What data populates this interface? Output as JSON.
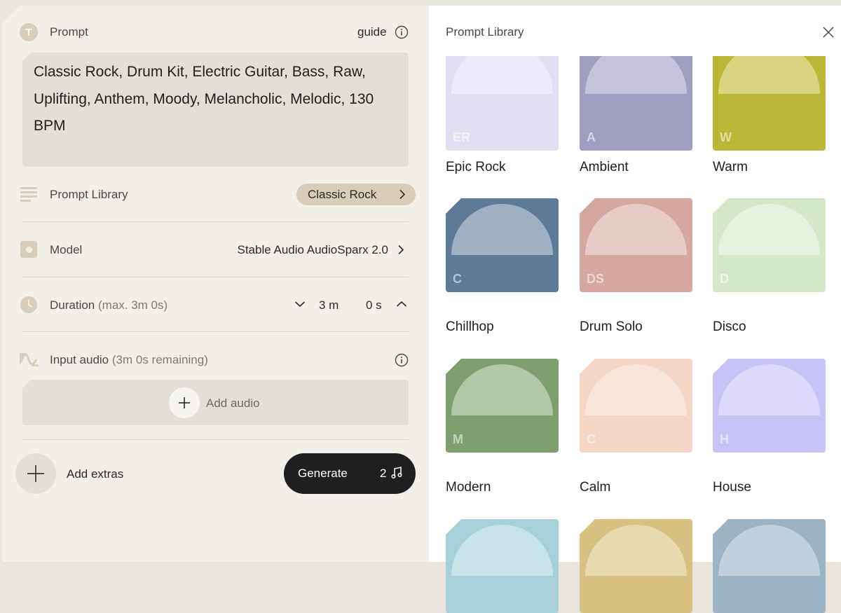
{
  "prompt_panel": {
    "title": "Prompt",
    "guide_label": "guide",
    "prompt_text": "Classic Rock, Drum Kit, Electric Guitar, Bass, Raw, Uplifting, Anthem, Moody, Melancholic, Melodic, 130 BPM",
    "prompt_library_label": "Prompt Library",
    "prompt_library_value": "Classic Rock",
    "model_label": "Model",
    "model_value": "Stable Audio AudioSparx 2.0",
    "duration_label": "Duration",
    "duration_hint": "(max. 3m 0s)",
    "duration_minutes": "3 m",
    "duration_seconds": "0 s",
    "input_audio_label": "Input audio",
    "input_audio_hint": "(3m 0s remaining)",
    "add_audio_label": "Add audio",
    "add_extras_label": "Add extras",
    "generate_label": "Generate",
    "generate_count": "2"
  },
  "library": {
    "title": "Prompt Library",
    "cards": [
      {
        "abbr": "ER",
        "title": "Epic Rock",
        "color": "#e2ddf0",
        "dome": "#ede9f6"
      },
      {
        "abbr": "A",
        "title": "Ambient",
        "color": "#a09fc0",
        "dome": "#c4c3d9"
      },
      {
        "abbr": "W",
        "title": "Warm",
        "color": "#bdb738",
        "dome": "#d8d482"
      },
      {
        "abbr": "C",
        "title": "Chillhop",
        "color": "#5d7a98",
        "dome": "#9fb0c3"
      },
      {
        "abbr": "DS",
        "title": "Drum Solo",
        "color": "#d6a6a0",
        "dome": "#e6cbc7"
      },
      {
        "abbr": "D",
        "title": "Disco",
        "color": "#d5e6cb",
        "dome": "#e6f0df"
      },
      {
        "abbr": "M",
        "title": "Modern",
        "color": "#7e9e6e",
        "dome": "#b3c6a8"
      },
      {
        "abbr": "C",
        "title": "Calm",
        "color": "#f3d6c4",
        "dome": "#f7e5da"
      },
      {
        "abbr": "H",
        "title": "House",
        "color": "#c7c3f7",
        "dome": "#dcd9fa"
      },
      {
        "abbr": "",
        "title": "",
        "color": "#a6d1d9",
        "dome": "#c8e3e8"
      },
      {
        "abbr": "",
        "title": "",
        "color": "#d9c184",
        "dome": "#e8daaf"
      },
      {
        "abbr": "",
        "title": "",
        "color": "#9bb3c5",
        "dome": "#c0d0dc"
      }
    ]
  }
}
